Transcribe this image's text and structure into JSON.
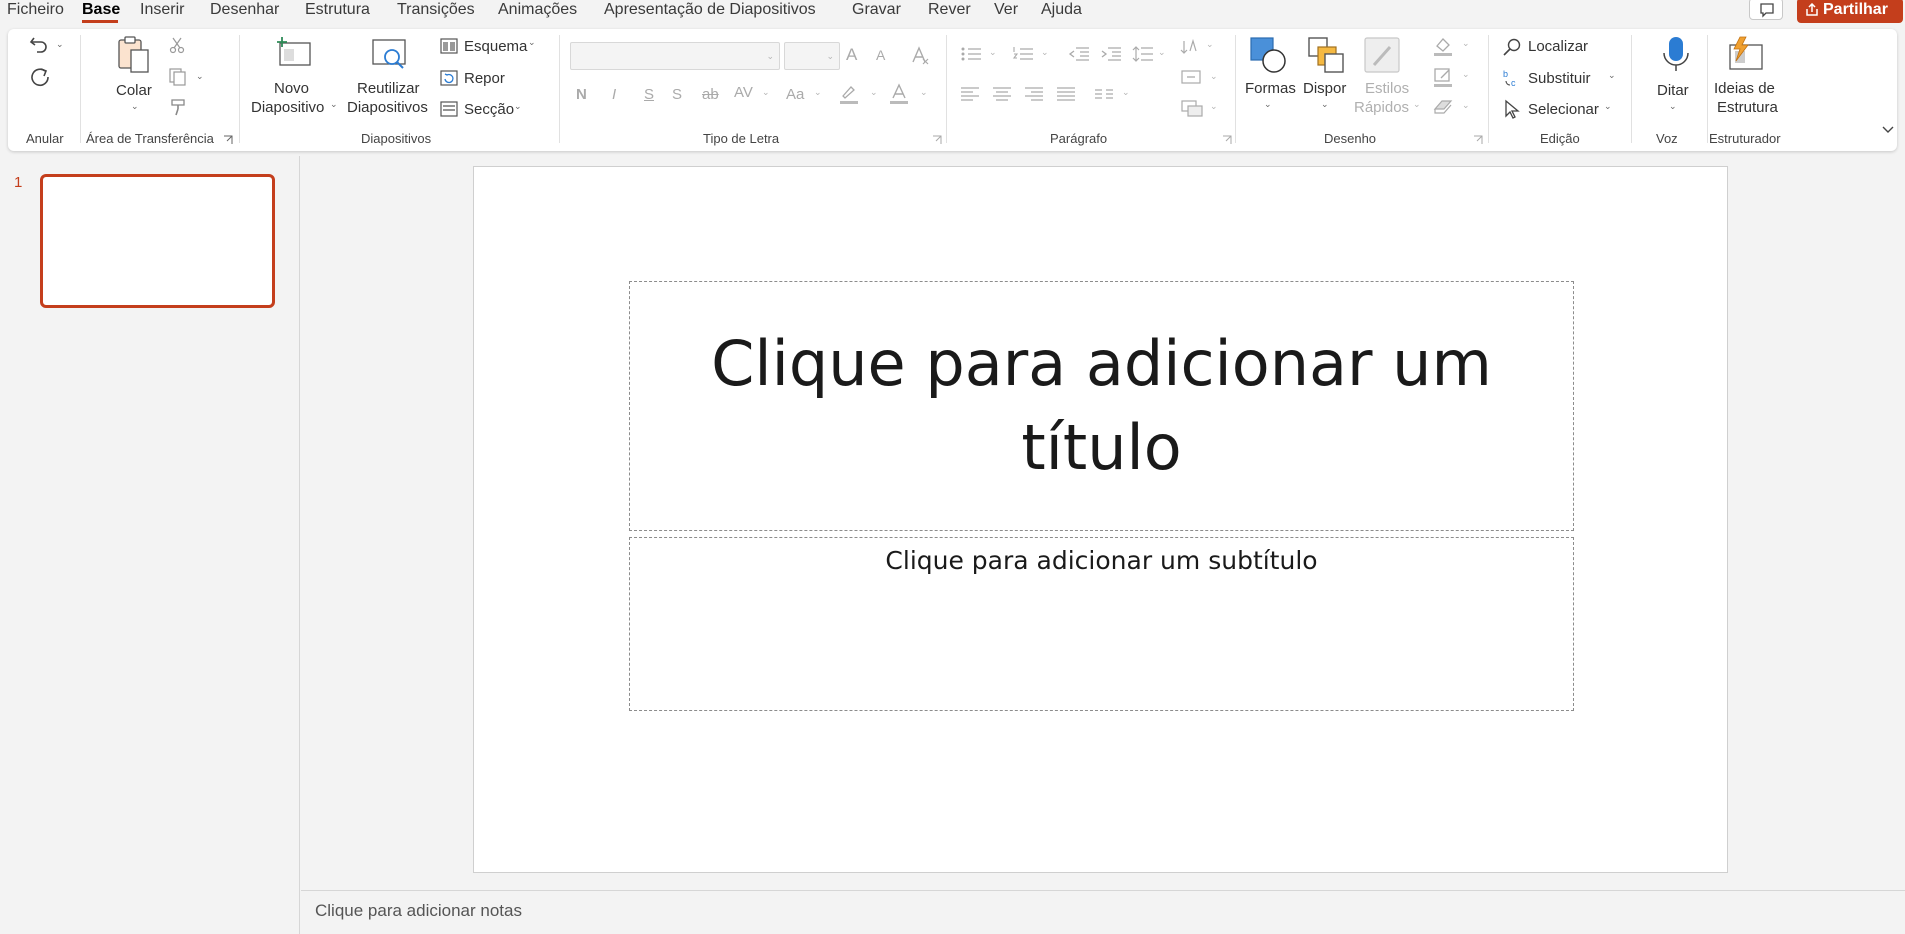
{
  "menu": {
    "items": [
      {
        "label": "Ficheiro"
      },
      {
        "label": "Base"
      },
      {
        "label": "Inserir"
      },
      {
        "label": "Desenhar"
      },
      {
        "label": "Estrutura"
      },
      {
        "label": "Transições"
      },
      {
        "label": "Animações"
      },
      {
        "label": "Apresentação de Diapositivos"
      },
      {
        "label": "Gravar"
      },
      {
        "label": "Rever"
      },
      {
        "label": "Ver"
      },
      {
        "label": "Ajuda"
      }
    ],
    "active": "Base",
    "share_label": "Partilhar"
  },
  "ribbon": {
    "groups": {
      "undo": "Anular",
      "clipboard": "Área de Transferência",
      "slides": "Diapositivos",
      "font": "Tipo de Letra",
      "paragraph": "Parágrafo",
      "drawing": "Desenho",
      "editing": "Edição",
      "voice": "Voz",
      "designer": "Estruturador"
    },
    "clipboard": {
      "paste": "Colar"
    },
    "slides": {
      "new_slide_1": "Novo",
      "new_slide_2": "Diapositivo",
      "reuse_1": "Reutilizar",
      "reuse_2": "Diapositivos",
      "layout": "Esquema",
      "reset": "Repor",
      "section": "Secção"
    },
    "drawing": {
      "shapes": "Formas",
      "arrange": "Dispor",
      "quick_styles_1": "Estilos",
      "quick_styles_2": "Rápidos"
    },
    "editing": {
      "find": "Localizar",
      "replace": "Substituir",
      "select": "Selecionar"
    },
    "voice": {
      "dictate": "Ditar"
    },
    "designer": {
      "ideas_1": "Ideias de",
      "ideas_2": "Estrutura"
    },
    "font_buttons": {
      "bold": "N",
      "italic": "I",
      "underline": "S",
      "shadow": "S",
      "strike": "ab",
      "spacing": "AV",
      "case": "Aa",
      "grow": "A",
      "shrink": "A"
    }
  },
  "thumbnails": [
    {
      "number": "1"
    }
  ],
  "slide": {
    "title_placeholder": "Clique para adicionar um título",
    "subtitle_placeholder": "Clique para adicionar um subtítulo"
  },
  "notes": {
    "placeholder": "Clique para adicionar notas"
  },
  "colors": {
    "accent": "#c43e1c",
    "ribbon_bg": "#ffffff",
    "app_bg": "#f3f3f3"
  }
}
